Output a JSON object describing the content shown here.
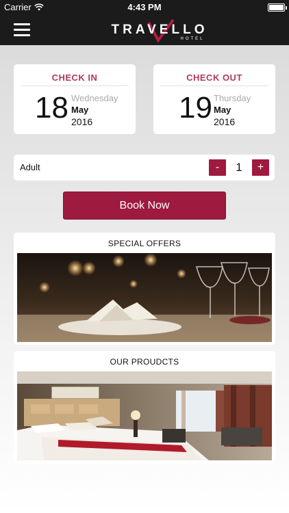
{
  "status_bar": {
    "carrier": "Carrier",
    "time": "4:43 PM"
  },
  "header": {
    "logo_main": "TRAVELLO",
    "logo_sub": "HOTEL"
  },
  "checkin": {
    "title": "CHECK IN",
    "day": "18",
    "weekday": "Wednesday",
    "month": "May",
    "year": "2016"
  },
  "checkout": {
    "title": "CHECK OUT",
    "day": "19",
    "weekday": "Thursday",
    "month": "May",
    "year": "2016"
  },
  "guests": {
    "label": "Adult",
    "count": "1",
    "minus": "-",
    "plus": "+"
  },
  "book_button": "Book Now",
  "sections": {
    "offers_title": "SPECIAL OFFERS",
    "products_title": "OUR PROUDCTS"
  },
  "colors": {
    "accent": "#9e1a3f",
    "title_accent": "#b03a5b",
    "header_bg": "#1b1b1b"
  },
  "icons": [
    "wifi-icon",
    "battery-icon",
    "menu-icon"
  ]
}
